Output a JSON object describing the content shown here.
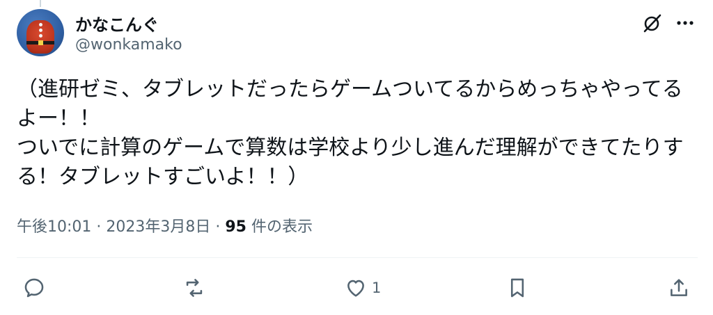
{
  "author": {
    "display_name": "かなこんぐ",
    "handle": "@wonkamako"
  },
  "tweet": {
    "text": "（進研ゼミ、タブレットだったらゲームついてるからめっちゃやってるよー！！\nついでに計算のゲームで算数は学校より少し進んだ理解ができてたりする！タブレットすごいよ！！）"
  },
  "meta": {
    "time": "午後10:01",
    "separator": " · ",
    "date": "2023年3月8日",
    "view_count": "95",
    "view_label": " 件の表示"
  },
  "actions": {
    "like_count": "1"
  },
  "icons": {
    "header": [
      "grok-icon",
      "more-icon"
    ],
    "actions": [
      "reply-icon",
      "repost-icon",
      "like-icon",
      "bookmark-icon",
      "share-icon"
    ]
  },
  "colors": {
    "text_primary": "#0f1419",
    "text_secondary": "#536471",
    "divider": "#eff3f4"
  }
}
